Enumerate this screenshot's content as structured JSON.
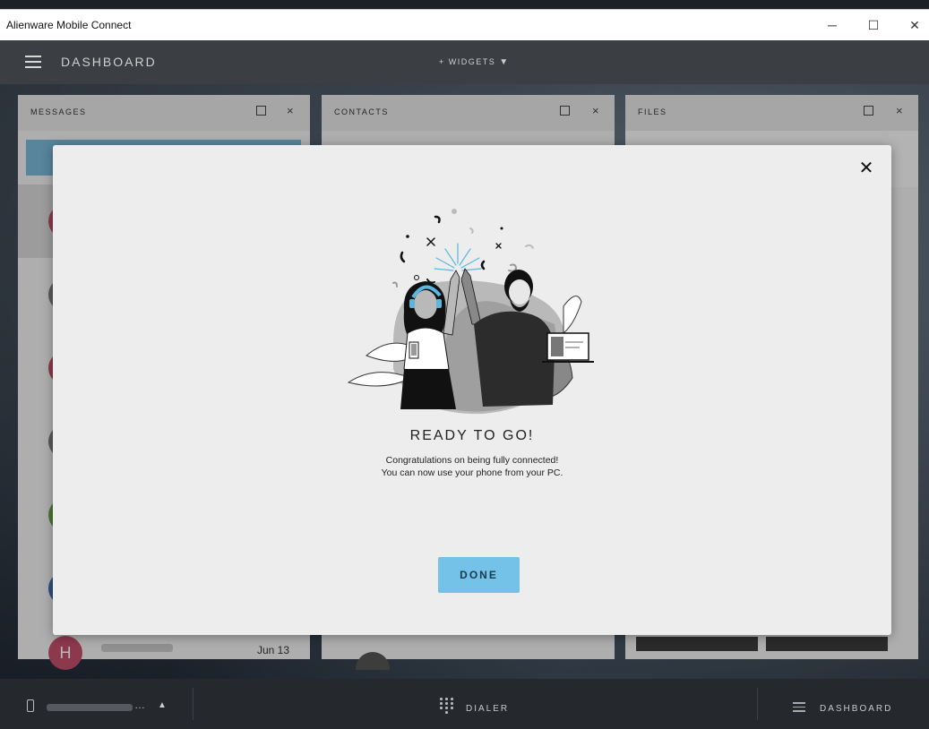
{
  "window": {
    "title": "Alienware Mobile Connect",
    "controls": {
      "minimize": "─",
      "maximize": "☐",
      "close": "✕"
    }
  },
  "header": {
    "title": "DASHBOARD",
    "widgets_label": "+ WIDGETS",
    "widgets_arrow": "▼"
  },
  "widgets": {
    "messages": {
      "title": "MESSAGES",
      "close": "×"
    },
    "contacts": {
      "title": "CONTACTS",
      "close": "×"
    },
    "files": {
      "title": "FILES",
      "close": "×"
    }
  },
  "messages_list": {
    "last_avatar_letter": "H",
    "last_date": "Jun 13"
  },
  "modal": {
    "close": "✕",
    "heading": "READY TO GO!",
    "line1": "Congratulations on being fully connected!",
    "line2": "You can now use your phone from your PC.",
    "done_label": "DONE"
  },
  "bottom_bar": {
    "device_ellipsis": "…",
    "device_caret": "▲",
    "dialer_label": "DIALER",
    "dashboard_label": "DASHBOARD"
  },
  "colors": {
    "accent": "#74c2e8",
    "modal_bg": "#ededed",
    "bottom_bar": "#25282c",
    "header_bar": "#3b3e43"
  }
}
